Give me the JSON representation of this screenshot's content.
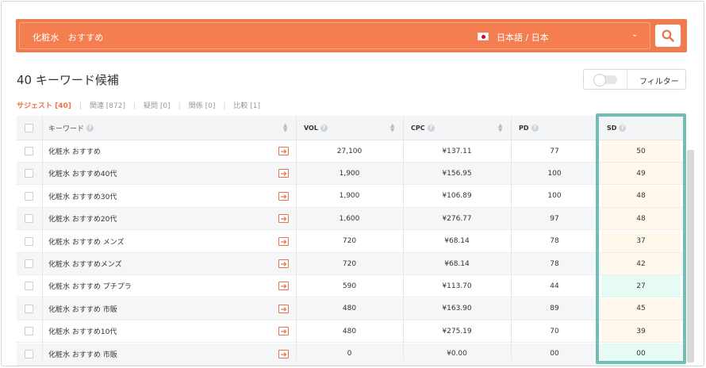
{
  "search": {
    "query": "化粧水　おすすめ",
    "language": "日本語 / 日本",
    "language_caret": "⌄"
  },
  "page_title": "40 キーワード候補",
  "filter": {
    "label": "フィルター"
  },
  "tabs": [
    {
      "label": "サジェスト [40]",
      "active": true
    },
    {
      "label": "関連 [872]",
      "active": false
    },
    {
      "label": "疑問 [0]",
      "active": false
    },
    {
      "label": "関係 [0]",
      "active": false
    },
    {
      "label": "比較 [1]",
      "active": false
    }
  ],
  "table": {
    "headers": {
      "keyword": "キーワード",
      "vol": "VOL",
      "cpc": "CPC",
      "pd": "PD",
      "sd": "SD"
    },
    "rows": [
      {
        "keyword": "化粧水 おすすめ",
        "vol": "27,100",
        "cpc": "¥137.11",
        "pd": "77",
        "sd": "50",
        "sd_color": "#fff8ec"
      },
      {
        "keyword": "化粧水 おすすめ40代",
        "vol": "1,900",
        "cpc": "¥156.95",
        "pd": "100",
        "sd": "49",
        "sd_color": "#fff8ec"
      },
      {
        "keyword": "化粧水 おすすめ30代",
        "vol": "1,900",
        "cpc": "¥106.89",
        "pd": "100",
        "sd": "48",
        "sd_color": "#fff8ec"
      },
      {
        "keyword": "化粧水 おすすめ20代",
        "vol": "1,600",
        "cpc": "¥276.77",
        "pd": "97",
        "sd": "48",
        "sd_color": "#fff8ec"
      },
      {
        "keyword": "化粧水 おすすめ メンズ",
        "vol": "720",
        "cpc": "¥68.14",
        "pd": "78",
        "sd": "37",
        "sd_color": "#fff8ec"
      },
      {
        "keyword": "化粧水 おすすめメンズ",
        "vol": "720",
        "cpc": "¥68.14",
        "pd": "78",
        "sd": "42",
        "sd_color": "#fff8ec"
      },
      {
        "keyword": "化粧水 おすすめ プチプラ",
        "vol": "590",
        "cpc": "¥113.70",
        "pd": "44",
        "sd": "27",
        "sd_color": "#e6fbf3"
      },
      {
        "keyword": "化粧水 おすすめ 市販",
        "vol": "480",
        "cpc": "¥163.90",
        "pd": "89",
        "sd": "45",
        "sd_color": "#fff8ec"
      },
      {
        "keyword": "化粧水 おすすめ10代",
        "vol": "480",
        "cpc": "¥275.19",
        "pd": "70",
        "sd": "39",
        "sd_color": "#fff8ec"
      },
      {
        "keyword": "化粧水 おすすめ 市販",
        "vol": "0",
        "cpc": "¥0.00",
        "pd": "00",
        "sd": "00",
        "sd_color": "#e6fbf3"
      }
    ]
  },
  "colors": {
    "accent": "#f07c4d",
    "highlight_border": "#6fbfb5"
  }
}
